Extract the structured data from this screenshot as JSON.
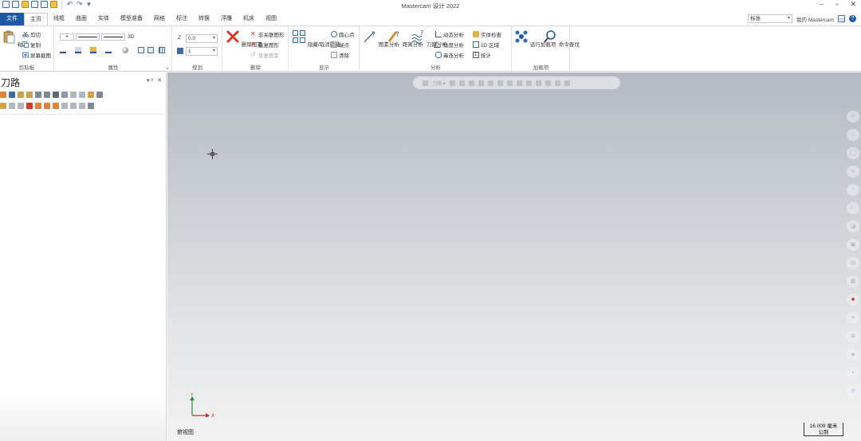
{
  "app": {
    "title": "Mastercam 设计 2022",
    "win_min": "–",
    "win_restore": "▫",
    "win_close": "✕"
  },
  "qat": {
    "undo": "↶",
    "redo": "↷",
    "more": "▾"
  },
  "tabs": [
    "文件",
    "主页",
    "线框",
    "曲面",
    "实体",
    "模型准备",
    "网格",
    "标注",
    "转换",
    "浮雕",
    "机床",
    "视图"
  ],
  "tabs_right": {
    "config_value": "标准",
    "my_mastercam": "我的 Mastercam",
    "help": "?"
  },
  "ribbon": {
    "clipboard": {
      "label": "剪贴板",
      "paste": "粘贴",
      "cut": "剪切",
      "copy": "复制",
      "screenshot": "屏幕截图"
    },
    "attributes": {
      "label": "属性",
      "dim_3d": "3D"
    },
    "planes": {
      "label": "规划",
      "z_label": "Z",
      "z_value": "0.0",
      "level_value": "1"
    },
    "delete": {
      "label": "删除",
      "delete_entities": "删除图素",
      "delete_related": "非关联图形",
      "delete_duplicates": "重复图形",
      "restore": "恢复图素"
    },
    "display": {
      "label": "显示",
      "hide_unhide": "隐藏/取消隐藏",
      "center_point": "圆心点",
      "endpoint": "端点",
      "clear": "清除"
    },
    "analyze": {
      "label": "分析",
      "entity_analysis": "图素分析",
      "distance_analysis": "距离分析",
      "toolpath_analysis": "刀路分析",
      "dynamic_analysis": "动态分析",
      "angle_analysis": "角度分析",
      "chain_analysis": "串连分析",
      "solid_check": "实体检查",
      "area_2d": "2D 区域",
      "statistics": "统计"
    },
    "addins": {
      "label": "加载项",
      "run_addin": "运行加载项",
      "command_finder": "命令查找"
    }
  },
  "left_panel": {
    "title": "刀路",
    "pin": "▾ ᵖ",
    "close": "✕"
  },
  "graphics": {
    "view_name": "俯视图",
    "scale_value": "16.009 毫米",
    "scale_unit": "公制",
    "axis_x": "X",
    "axis_y": "Y",
    "float_label": "刀路 ▾"
  },
  "colors": {
    "file_tab": "#1d5aa6",
    "accent_blue": "#2b6cb8",
    "delete_red": "#d33a2c",
    "gfx_top": "#b3bac2",
    "gfx_bottom": "#f2f2f2"
  }
}
